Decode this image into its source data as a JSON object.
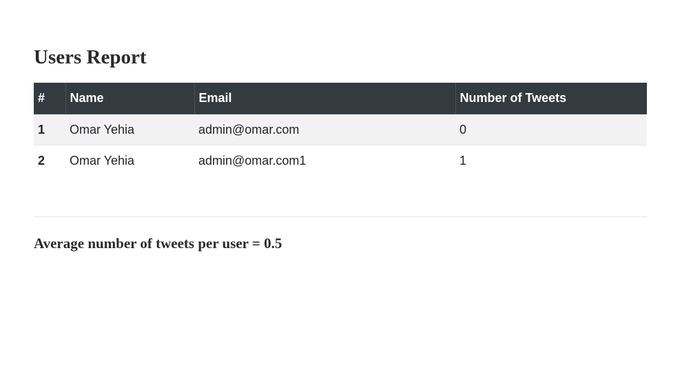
{
  "page": {
    "title": "Users Report",
    "summary": "Average number of tweets per user = 0.5"
  },
  "table": {
    "headers": [
      "#",
      "Name",
      "Email",
      "Number of Tweets"
    ],
    "rows": [
      {
        "num": "1",
        "name": "Omar Yehia",
        "email": "admin@omar.com",
        "tweets": "0"
      },
      {
        "num": "2",
        "name": "Omar Yehia",
        "email": "admin@omar.com1",
        "tweets": "1"
      }
    ]
  }
}
